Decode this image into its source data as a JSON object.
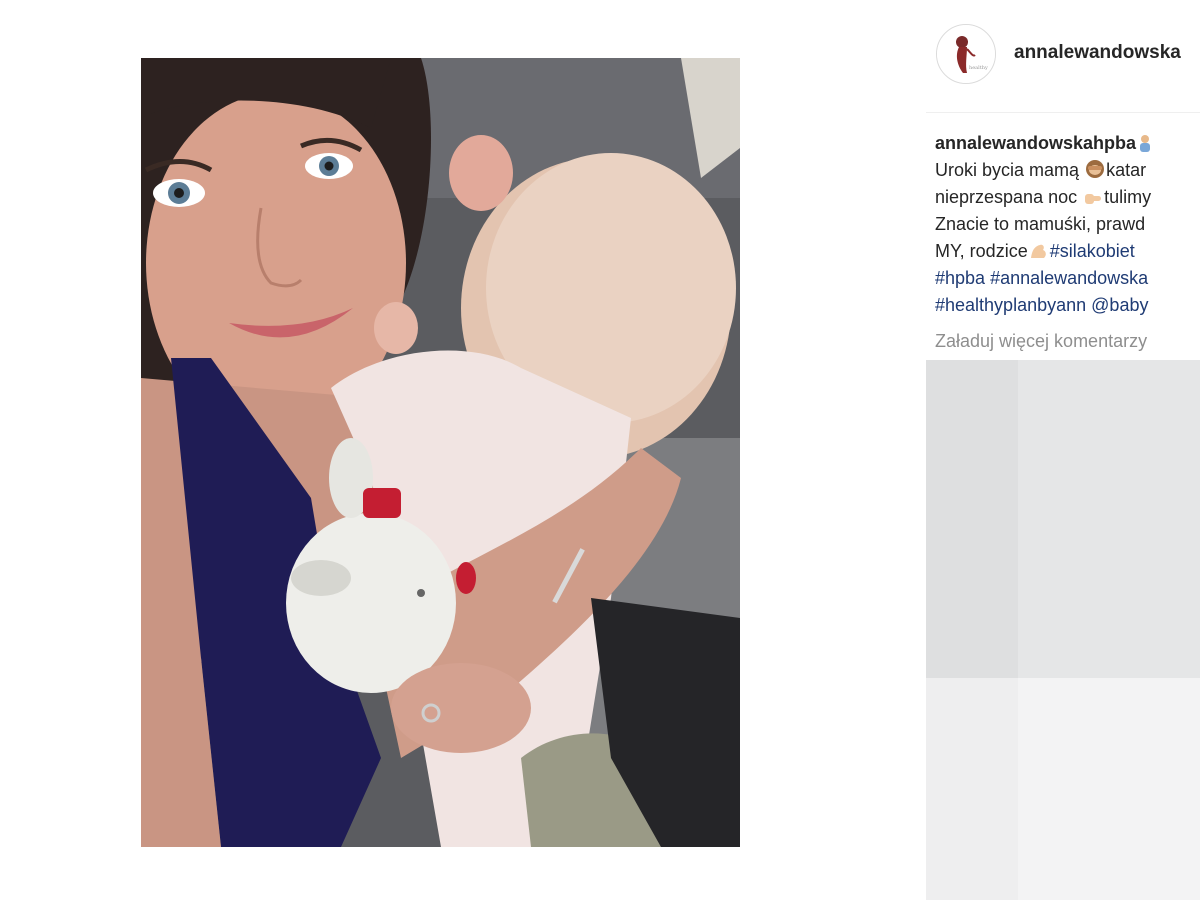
{
  "post": {
    "username": "annalewandowska",
    "avatar_alt": "healthy plan by ann logo",
    "caption_lines": [
      {
        "user": "annalewandowskahpba"
      },
      {
        "text": "Uroki bycia mamą",
        "after": "katar"
      },
      {
        "text": "nieprzespana noc",
        "after": "tulimy"
      },
      {
        "text": "Znacie to mamuśki, prawd"
      },
      {
        "text": "MY, rodzice",
        "tag": "#silakobiet"
      },
      {
        "tag1": "#hpba",
        "tag2": "#annalewandowska"
      },
      {
        "tag1": "#healthyplanbyann",
        "tag2": "@baby"
      }
    ],
    "load_more": "Załaduj więcej komentarzy"
  },
  "icons": {
    "avatar": "woman-silhouette-logo",
    "emoji_1": "woman-emoji-icon",
    "emoji_2": "see-no-evil-monkey-emoji-icon",
    "emoji_3": "pointing-right-emoji-icon",
    "emoji_4": "flexed-biceps-emoji-icon"
  },
  "colors": {
    "hashtag": "#1f3b74",
    "muted": "#8e8e8e",
    "text": "#262626"
  }
}
